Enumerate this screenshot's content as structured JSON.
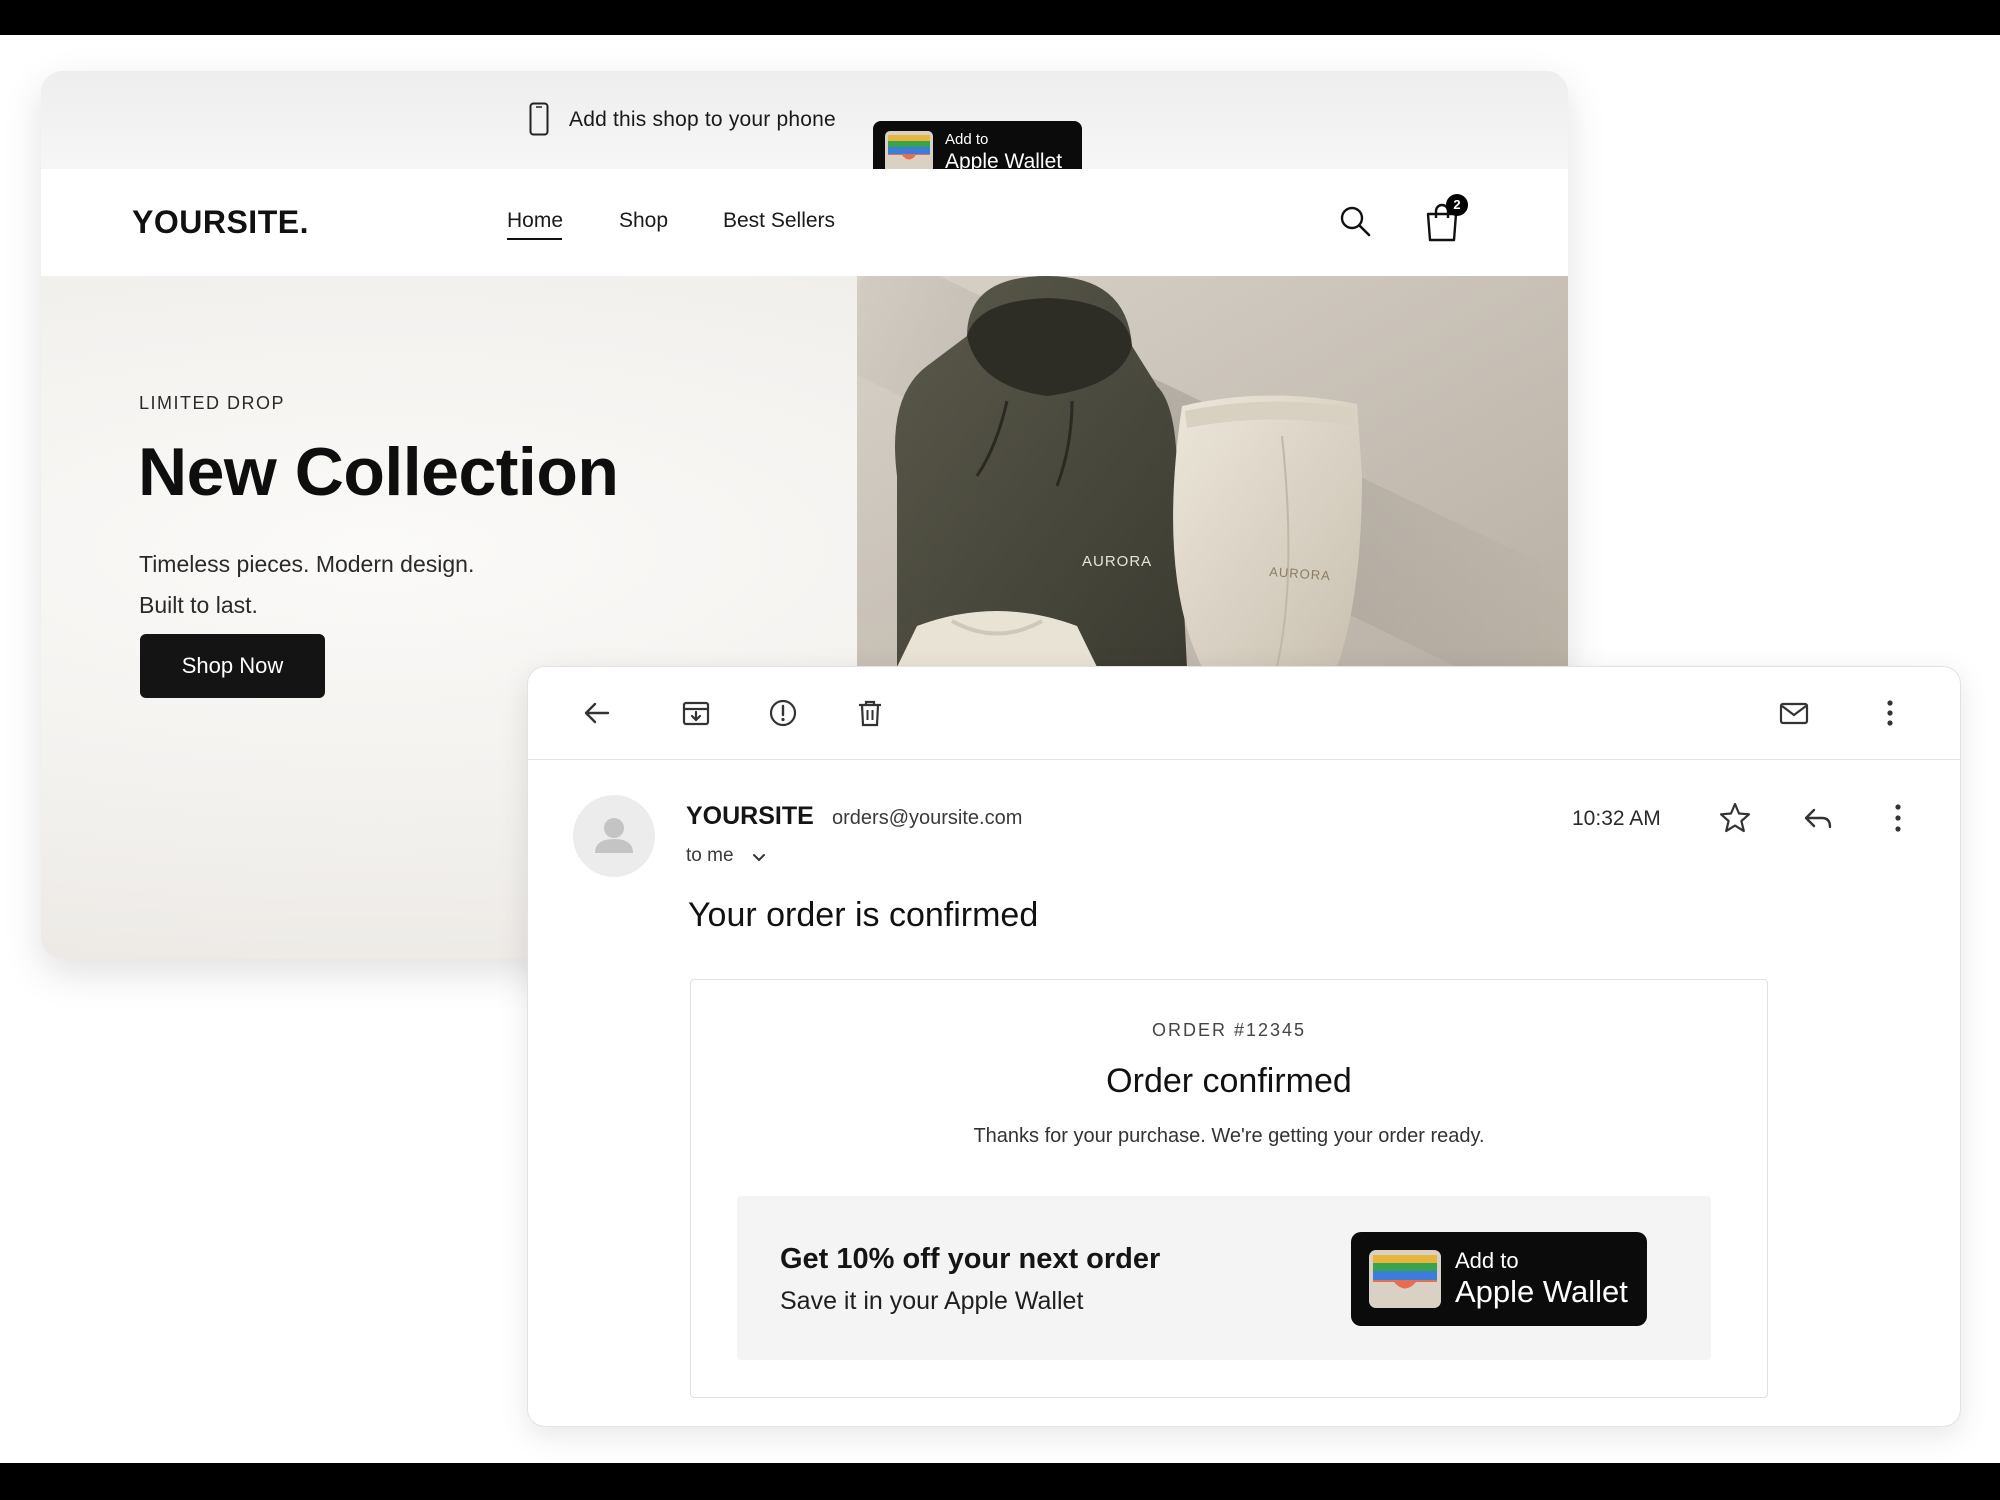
{
  "store": {
    "promo_bar": {
      "text": "Add this shop to your phone",
      "wallet_line1": "Add to",
      "wallet_line2": "Apple Wallet"
    },
    "logo": "YOURSITE.",
    "nav": {
      "home": "Home",
      "shop": "Shop",
      "best_sellers": "Best Sellers"
    },
    "cart_count": "2",
    "hero": {
      "eyebrow": "LIMITED DROP",
      "title": "New Collection",
      "subtitle_line1": "Timeless pieces. Modern design.",
      "subtitle_line2": "Built to last.",
      "cta": "Shop Now",
      "garment_label": "AURORA"
    }
  },
  "email": {
    "sender_name": "YOURSITE",
    "sender_email": "orders@yoursite.com",
    "to": "to me",
    "time": "10:32 AM",
    "subject": "Your order is confirmed",
    "body": {
      "order_number": "ORDER #12345",
      "heading": "Order confirmed",
      "thanks": "Thanks for your purchase. We're getting your order ready.",
      "offer_title": "Get 10% off your next order",
      "offer_subtitle": "Save it in your Apple Wallet",
      "wallet_line1": "Add to",
      "wallet_line2": "Apple Wallet"
    }
  },
  "colors": {
    "button_dark": "#141414",
    "wallet_black": "#0b0b0b",
    "hoodie": "#4b4a3d",
    "sweatpants": "#ddd6c8"
  }
}
